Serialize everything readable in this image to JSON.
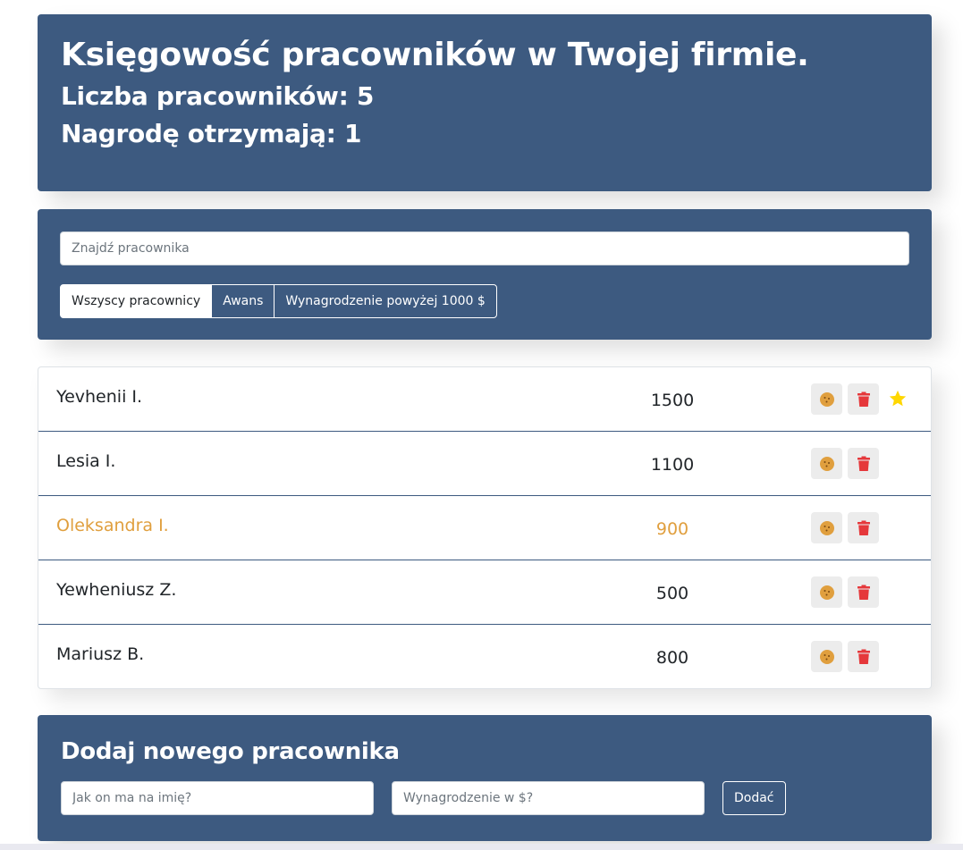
{
  "header": {
    "title": "Księgowość pracowników w Twojej firmie.",
    "employee_count_text": "Liczba pracowników: 5",
    "award_count_text": "Nagrodę otrzymają: 1"
  },
  "search": {
    "placeholder": "Znajdź pracownika"
  },
  "filters": [
    {
      "label": "Wszyscy pracownicy",
      "active": true
    },
    {
      "label": "Awans",
      "active": false
    },
    {
      "label": "Wynagrodzenie powyżej 1000 $",
      "active": false
    }
  ],
  "employees": [
    {
      "name": "Yevhenii I.",
      "salary": "1500",
      "increase": false,
      "rise": true
    },
    {
      "name": "Lesia I.",
      "salary": "1100",
      "increase": false,
      "rise": false
    },
    {
      "name": "Oleksandra I.",
      "salary": "900",
      "increase": true,
      "rise": false
    },
    {
      "name": "Yewheniusz Z.",
      "salary": "500",
      "increase": false,
      "rise": false
    },
    {
      "name": "Mariusz B.",
      "salary": "800",
      "increase": false,
      "rise": false
    }
  ],
  "icons": {
    "increase_button": "cookie-icon",
    "delete_button": "trash-icon",
    "rise_marker": "star-icon"
  },
  "colors": {
    "panel_bg": "#3d5a80",
    "cookie": "#e09f3e",
    "trash": "#e5383b",
    "star": "#ffd700",
    "increase_text": "#e09f3e"
  },
  "add_form": {
    "title": "Dodaj nowego pracownika",
    "name_placeholder": "Jak on ma na imię?",
    "salary_placeholder": "Wynagrodzenie w $?",
    "submit_label": "Dodać"
  }
}
